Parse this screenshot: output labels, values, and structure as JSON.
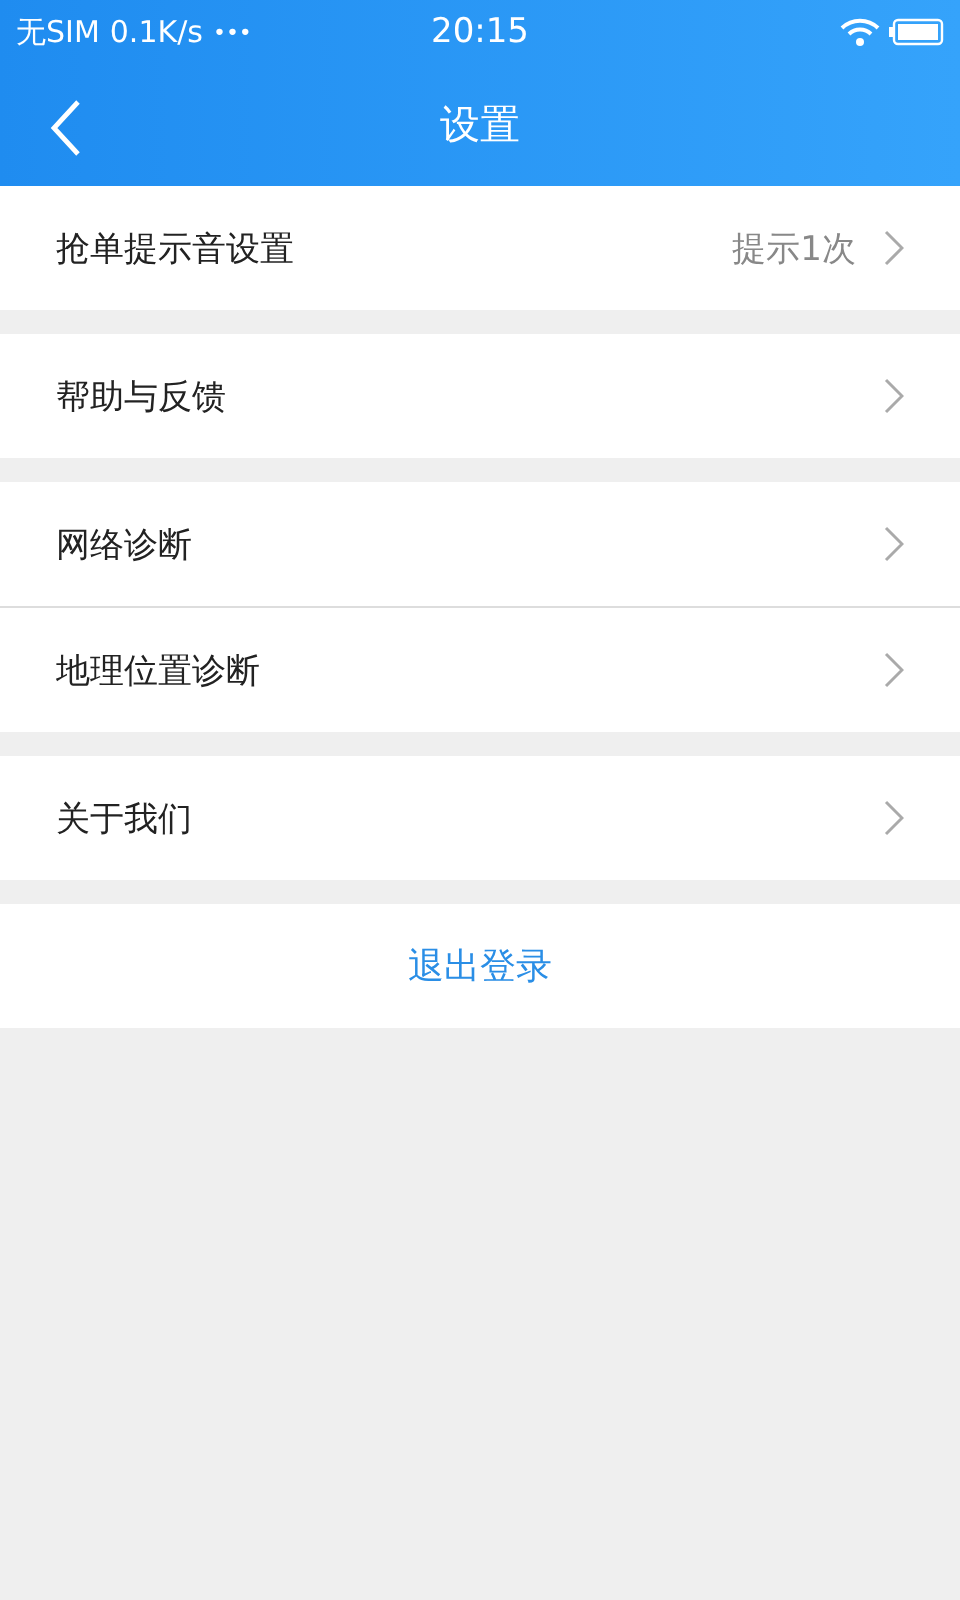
{
  "status_bar": {
    "carrier": "无SIM",
    "speed": "0.1K/s",
    "dots": "•••",
    "time": "20:15"
  },
  "nav": {
    "title": "设置"
  },
  "groups": [
    [
      {
        "label": "抢单提示音设置",
        "value": "提示1次"
      }
    ],
    [
      {
        "label": "帮助与反馈"
      }
    ],
    [
      {
        "label": "网络诊断"
      },
      {
        "label": "地理位置诊断"
      }
    ],
    [
      {
        "label": "关于我们"
      }
    ]
  ],
  "logout": "退出登录"
}
